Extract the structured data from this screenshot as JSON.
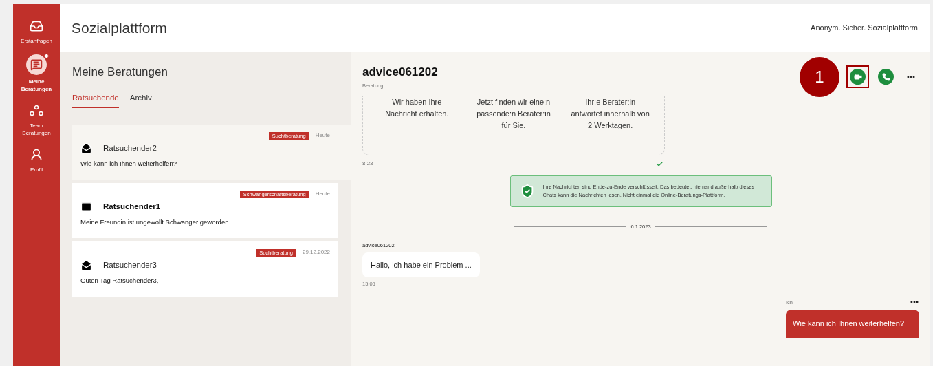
{
  "sidebar": {
    "items": [
      {
        "label": "Erstanfragen",
        "kind": "inbox",
        "selected": false,
        "notification": false
      },
      {
        "label": "Meine Beratungen",
        "kind": "chat",
        "selected": true,
        "notification": true
      },
      {
        "label": "Team Beratungen",
        "kind": "team",
        "selected": false,
        "notification": false
      },
      {
        "label": "Profil",
        "kind": "profile",
        "selected": false,
        "notification": false
      }
    ]
  },
  "header": {
    "title": "Sozialplattform",
    "tagline": "Anonym. Sicher. Sozialplattform"
  },
  "list_panel": {
    "title": "Meine Beratungen",
    "tabs": [
      {
        "label": "Ratsuchende",
        "selected": true
      },
      {
        "label": "Archiv",
        "selected": false
      }
    ],
    "conversations": [
      {
        "tag": "Suchtberatung",
        "date": "Heute",
        "name": "Ratsuchender2",
        "preview": "Wie kann ich Ihnen weiterhelfen?",
        "unread": false,
        "selected": true
      },
      {
        "tag": "Schwangerschaftsberatung",
        "date": "Heute",
        "name": "Ratsuchender1",
        "preview": "Meine Freundin ist ungewollt Schwanger geworden ...",
        "unread": true,
        "selected": false
      },
      {
        "tag": "Suchtberatung",
        "date": "29.12.2022",
        "name": "Ratsuchender3",
        "preview": "Guten Tag Ratsuchender3,",
        "unread": false,
        "selected": false
      }
    ]
  },
  "chat": {
    "title": "advice061202",
    "subtitle": "Beratung",
    "actions": [
      {
        "kind": "video",
        "highlighted": true
      },
      {
        "kind": "phone",
        "highlighted": false
      },
      {
        "kind": "more",
        "highlighted": false
      }
    ],
    "annotation": "1",
    "steps": [
      "Wir haben Ihre Nachricht erhalten.",
      "Jetzt finden wir eine:n passende:n Berater:in für Sie.",
      "Ihr:e Berater:in antwortet innerhalb von 2 Werktagen."
    ],
    "steps_time": "8:23",
    "steps_read": true,
    "notice": "Ihre Nachrichten sind Ende-zu-Ende verschlüsselt. Das bedeutet, niemand außerhalb dieses Chats kann die Nachrichten lesen. Nicht einmal die Online-Beratungs-Plattform.",
    "date_divider": "6.1.2023",
    "messages": [
      {
        "kind": "incoming",
        "sender": "advice061202",
        "text": "Hallo, ich habe ein Problem ...",
        "time": "15:05"
      },
      {
        "kind": "outgoing",
        "sender": "Ich",
        "text": "Wie kann ich Ihnen weiterhelfen?"
      }
    ]
  }
}
